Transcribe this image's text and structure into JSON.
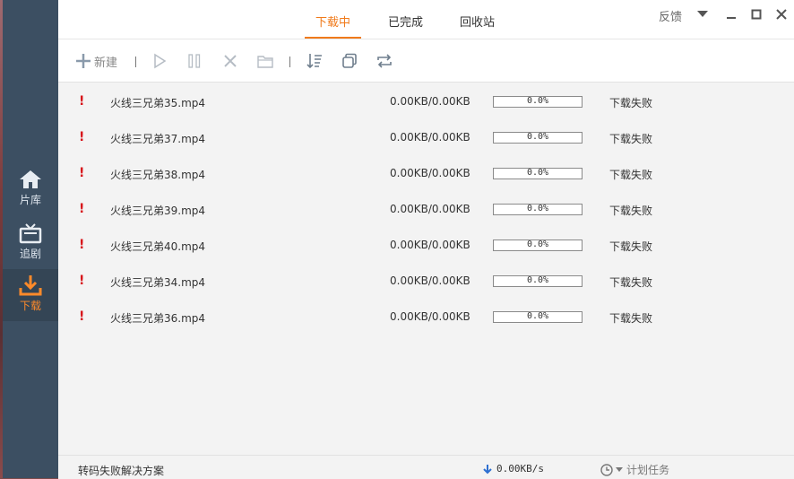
{
  "sidebar": {
    "items": [
      {
        "label": "片库",
        "icon": "home-icon"
      },
      {
        "label": "追剧",
        "icon": "tv-icon"
      },
      {
        "label": "下载",
        "icon": "download-icon"
      }
    ]
  },
  "tabs": [
    {
      "label": "下载中",
      "active": true
    },
    {
      "label": "已完成",
      "active": false
    },
    {
      "label": "回收站",
      "active": false
    }
  ],
  "header": {
    "feedback": "反馈"
  },
  "toolbar": {
    "new_label": "新建"
  },
  "downloads": [
    {
      "name": "火线三兄弟35.mp4",
      "size": "0.00KB/0.00KB",
      "progress_text": "0.0%",
      "progress": 0.0,
      "status": "下载失败"
    },
    {
      "name": "火线三兄弟37.mp4",
      "size": "0.00KB/0.00KB",
      "progress_text": "0.0%",
      "progress": 0.0,
      "status": "下载失败"
    },
    {
      "name": "火线三兄弟38.mp4",
      "size": "0.00KB/0.00KB",
      "progress_text": "0.0%",
      "progress": 0.0,
      "status": "下载失败"
    },
    {
      "name": "火线三兄弟39.mp4",
      "size": "0.00KB/0.00KB",
      "progress_text": "0.0%",
      "progress": 0.0,
      "status": "下载失败"
    },
    {
      "name": "火线三兄弟40.mp4",
      "size": "0.00KB/0.00KB",
      "progress_text": "0.0%",
      "progress": 0.0,
      "status": "下载失败"
    },
    {
      "name": "火线三兄弟34.mp4",
      "size": "0.00KB/0.00KB",
      "progress_text": "0.0%",
      "progress": 0.0,
      "status": "下载失败"
    },
    {
      "name": "火线三兄弟36.mp4",
      "size": "0.00KB/0.00KB",
      "progress_text": "0.0%",
      "progress": 0.0,
      "status": "下载失败"
    }
  ],
  "error_mark": "!",
  "footer": {
    "help_link": "转码失败解决方案",
    "speed": "0.00KB/s",
    "plan_label": "计划任务"
  },
  "colors": {
    "accent": "#f07a1a",
    "sidebar_bg": "#3c4f62",
    "error": "#d7141a"
  }
}
